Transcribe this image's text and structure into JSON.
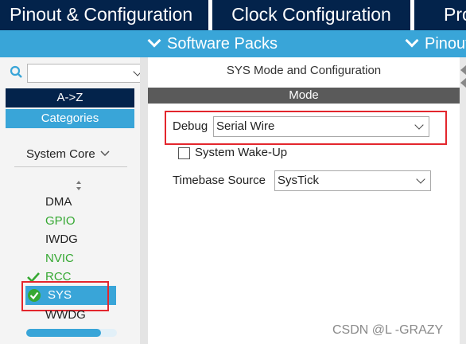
{
  "tabs": [
    {
      "label": "Pinout & Configuration",
      "active": true
    },
    {
      "label": "Clock Configuration",
      "active": false
    },
    {
      "label": "Pro",
      "active": false
    }
  ],
  "subbar": {
    "software_packs": "Software Packs",
    "pinout": "Pinout"
  },
  "left": {
    "search": {
      "value": "",
      "placeholder": ""
    },
    "az_label": "A->Z",
    "categories_label": "Categories",
    "section": "System Core",
    "items": [
      {
        "label": "DMA",
        "state": "normal"
      },
      {
        "label": "GPIO",
        "state": "enabled"
      },
      {
        "label": "IWDG",
        "state": "normal"
      },
      {
        "label": "NVIC",
        "state": "enabled"
      },
      {
        "label": "RCC",
        "state": "configured"
      },
      {
        "label": "SYS",
        "state": "selected"
      },
      {
        "label": "WWDG",
        "state": "normal"
      }
    ]
  },
  "right": {
    "title": "SYS Mode and Configuration",
    "mode_header": "Mode",
    "debug_label": "Debug",
    "debug_value": "Serial Wire",
    "wakeup_label": "System Wake-Up",
    "wakeup_checked": false,
    "timebase_label": "Timebase Source",
    "timebase_value": "SysTick"
  },
  "watermark": "CSDN @L -GRAZY",
  "colors": {
    "navy": "#03234b",
    "blue": "#39a5d8",
    "green": "#35a832",
    "red": "#e3262d",
    "mode_bar": "#5a5a5a"
  }
}
